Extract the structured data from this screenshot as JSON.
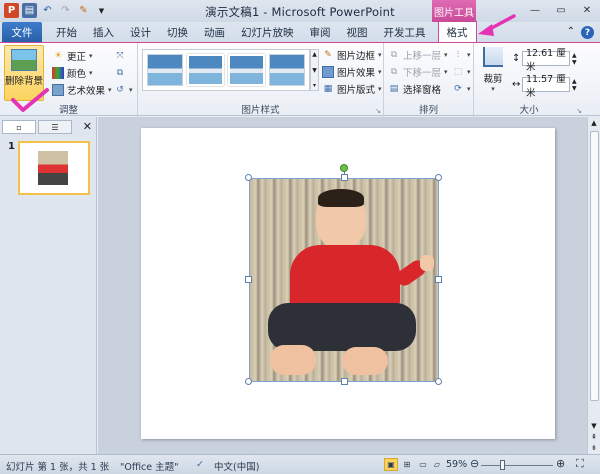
{
  "titlebar": {
    "app_icon": "P",
    "title": "演示文稿1 - Microsoft PowerPoint",
    "context_tab_group": "图片工具",
    "icons": [
      "powerpoint-icon",
      "save-icon",
      "undo-icon",
      "redo-icon",
      "format-painter-icon",
      "customize-qat-icon"
    ]
  },
  "tabs": [
    "文件",
    "开始",
    "插入",
    "设计",
    "切换",
    "动画",
    "幻灯片放映",
    "审阅",
    "视图",
    "开发工具",
    "格式"
  ],
  "ribbon": {
    "adjust": {
      "remove_background": "删除背景",
      "corrections": "更正",
      "color": "颜色",
      "artistic_effects": "艺术效果",
      "label": "调整"
    },
    "picture_styles": {
      "border": "图片边框",
      "effects": "图片效果",
      "layout": "图片版式",
      "label": "图片样式"
    },
    "arrange": {
      "bring_forward": "上移一层",
      "send_backward": "下移一层",
      "selection_pane": "选择窗格",
      "label": "排列"
    },
    "size": {
      "crop": "裁剪",
      "height": "12.61 厘米",
      "width": "11.57 厘米",
      "label": "大小"
    }
  },
  "slide_panel": {
    "slide_number": "1"
  },
  "status": {
    "slide_info": "幻灯片 第 1 张，共 1 张",
    "theme": "\"Office 主题\"",
    "language": "中文(中国)",
    "zoom": "59%"
  },
  "colors": {
    "file_tab": "#2a5fa8",
    "context_tab": "#c94a97",
    "annotation": "#e633b5",
    "selection_handle": "#5f82ad"
  }
}
